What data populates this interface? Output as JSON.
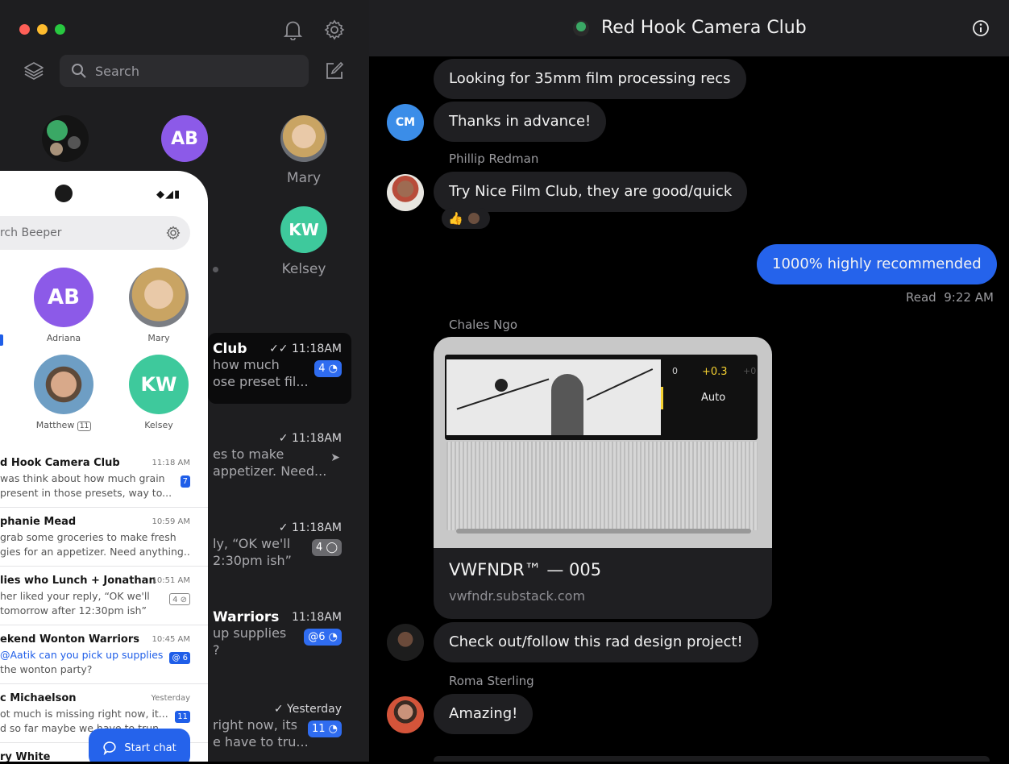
{
  "sidebar": {
    "search_placeholder": "Search",
    "favorites": [
      {
        "name": "Mary"
      },
      {
        "name": "Kelsey"
      }
    ],
    "chats": [
      {
        "title": "Club",
        "time": "11:18AM",
        "lines": [
          "how much",
          "ose preset fil..."
        ],
        "badge": "4"
      },
      {
        "title": "",
        "time": "11:18AM",
        "lines": [
          "es to make",
          "appetizer. Need..."
        ],
        "badge": ""
      },
      {
        "title": "",
        "time": "11:18AM",
        "lines": [
          "ly, “OK we'll",
          "2:30pm ish”"
        ],
        "badge": "4"
      },
      {
        "title": "Warriors",
        "time": "11:18AM",
        "lines": [
          "up supplies",
          "?"
        ],
        "badge": "@6"
      },
      {
        "title": "",
        "time": "Yesterday",
        "lines": [
          "right now, its",
          "e have to tru..."
        ],
        "badge": "11"
      }
    ]
  },
  "phone": {
    "search_placeholder": "rch Beeper",
    "favorites": [
      {
        "name": "Adriana"
      },
      {
        "name": "Mary"
      },
      {
        "name": "Matthew",
        "badge": "11"
      },
      {
        "name": "Kelsey"
      }
    ],
    "chats": [
      {
        "title": "d Hook Camera Club",
        "time": "11:18 AM",
        "lines": [
          "was think about how much grain",
          "present in those presets, way to..."
        ],
        "badge": "7"
      },
      {
        "title": "phanie Mead",
        "time": "10:59 AM",
        "lines": [
          "grab some groceries to make fresh",
          "gies for an appetizer. Need anything..."
        ],
        "badge": ""
      },
      {
        "title": "lies who Lunch + Jonathan",
        "time": "10:51 AM",
        "lines": [
          "her liked your reply, “OK we'll",
          " tomorrow after 12:30pm ish”"
        ],
        "badge": "4"
      },
      {
        "title": "ekend Wonton Warriors",
        "time": "10:45 AM",
        "lines": [
          "@Aatik can you pick up supplies",
          "the wonton party?"
        ],
        "badge": "@ 6"
      },
      {
        "title": "c Michaelson",
        "time": "Yesterday",
        "lines": [
          "ot much is missing right now, it...",
          "d so far maybe we have to trun..."
        ],
        "badge": "11"
      },
      {
        "title": "ry White",
        "time": "",
        "lines": [],
        "badge": ""
      }
    ],
    "start_chat_label": "Start chat"
  },
  "chat": {
    "title": "Red Hook Camera Club",
    "messages": [
      {
        "text": "Looking for 35mm film processing recs"
      },
      {
        "text": "Thanks in advance!"
      },
      {
        "sender": "Phillip Redman",
        "text": "Try Nice Film Club, they are good/quick",
        "reaction": "👍"
      },
      {
        "text": "1000% highly recommended",
        "outgoing": true,
        "status": "Read",
        "time": "9:22 AM"
      },
      {
        "sender": "Chales Ngo",
        "link": {
          "title": "VWFNDR™ — 005",
          "domain": "vwfndr.substack.com",
          "ui_left": "0",
          "ui_value": "+0.3",
          "ui_right": "+0",
          "ui_mode": "Auto"
        }
      },
      {
        "text": "Check out/follow this rad design project!"
      },
      {
        "sender": "Roma Sterling",
        "text": "Amazing!"
      }
    ]
  },
  "colors": {
    "accent": "#2563eb",
    "sidebar_bg": "#1e1e20",
    "bubble_bg": "#1f1f22"
  }
}
